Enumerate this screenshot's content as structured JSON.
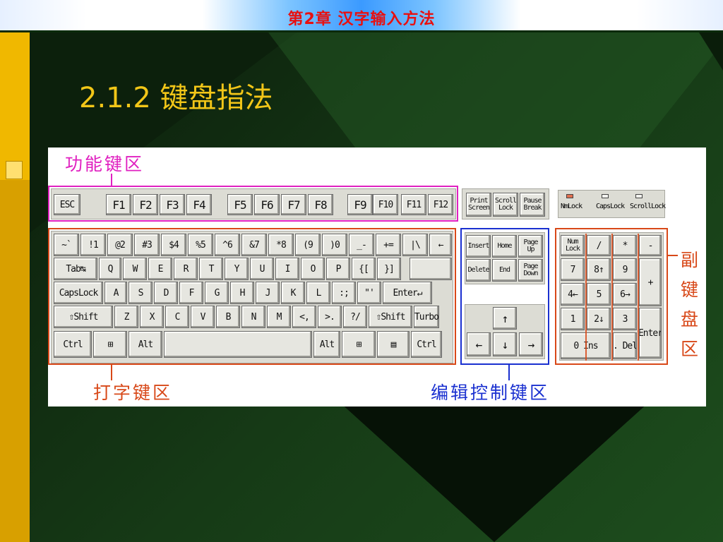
{
  "header": {
    "chapter": "第2章    汉字输入方法"
  },
  "title": "2.1.2 键盘指法",
  "colors": {
    "header_text": "#e81010",
    "title_text": "#f2c618",
    "function_zone": "#e020c0",
    "typing_zone": "#d84818",
    "editing_zone": "#1a30d0",
    "keypad_zone": "#d84818"
  },
  "labels": {
    "function_zone": "功能键区",
    "typing_zone": "打字键区",
    "editing_zone": "编辑控制键区",
    "keypad_zone": [
      "副",
      "键",
      "盘",
      "区"
    ]
  },
  "keyboard": {
    "function_row": [
      "ESC",
      "F1",
      "F2",
      "F3",
      "F4",
      "F5",
      "F6",
      "F7",
      "F8",
      "F9",
      "F10",
      "F11",
      "F12"
    ],
    "system_keys": [
      "Print Screen",
      "Scroll Lock",
      "Pause Break"
    ],
    "indicators": [
      "NmLock",
      "CapsLock",
      "ScrollLock"
    ],
    "row1": [
      "~`",
      "!1",
      "@2",
      "#3",
      "$4",
      "%5",
      "^6",
      "&7",
      "*8",
      "(9",
      ")0",
      "_-",
      "+=",
      "|\\",
      "←"
    ],
    "row2": [
      "Tab↹",
      "Q",
      "W",
      "E",
      "R",
      "T",
      "Y",
      "U",
      "I",
      "O",
      "P",
      "{[",
      "}]"
    ],
    "row3": [
      "CapsLock",
      "A",
      "S",
      "D",
      "F",
      "G",
      "H",
      "J",
      "K",
      "L",
      ":;",
      "\"'",
      "Enter↵"
    ],
    "row4": [
      "⇧Shift",
      "Z",
      "X",
      "C",
      "V",
      "B",
      "N",
      "M",
      "<,",
      ">.",
      "?/",
      "⇧Shift",
      "Turbo"
    ],
    "row5": [
      "Ctrl",
      "⊞",
      "Alt",
      "",
      "Alt",
      "⊞",
      "▤",
      "Ctrl"
    ],
    "editing": [
      "Insert",
      "Home",
      "Page Up",
      "Delete",
      "End",
      "Page Down"
    ],
    "arrows": [
      "↑",
      "←",
      "↓",
      "→"
    ],
    "keypad": [
      "Num Lock",
      "/",
      "*",
      "-",
      "7",
      "8↑",
      "9",
      "+",
      "4←",
      "5",
      "6→",
      "1",
      "2↓",
      "3",
      "Enter",
      "0 Ins",
      ". Del"
    ]
  }
}
